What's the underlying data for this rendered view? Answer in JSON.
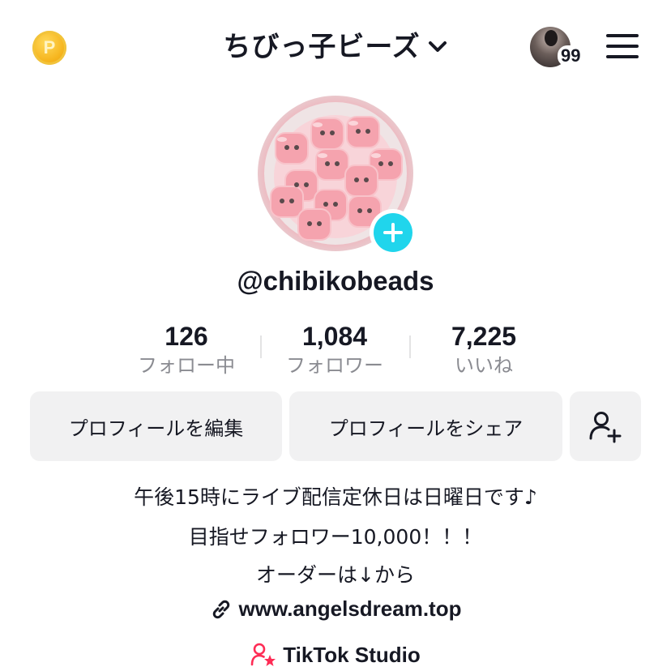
{
  "header": {
    "coin_symbol": "P",
    "title": "ちびっ子ビーズ",
    "notification_count": "99"
  },
  "profile": {
    "username": "@chibikobeads"
  },
  "stats": [
    {
      "value": "126",
      "label": "フォロー中"
    },
    {
      "value": "1,084",
      "label": "フォロワー"
    },
    {
      "value": "7,225",
      "label": "いいね"
    }
  ],
  "actions": {
    "edit_profile": "プロフィールを編集",
    "share_profile": "プロフィールをシェア"
  },
  "bio": {
    "line1": "午後15時にライブ配信定休日は日曜日です♪",
    "line2": "目指せフォロワー10,000！！！",
    "line3": "オーダーは↓から"
  },
  "link": {
    "url": "www.angelsdream.top"
  },
  "studio": {
    "label": "TikTok Studio"
  },
  "colors": {
    "accent": "#20d5ec",
    "studio_icon": "#fe2c55",
    "coin": "#f6b51e",
    "button_bg": "#f1f1f2",
    "muted_text": "#8a8b91"
  },
  "icons": {
    "coin": "coin-icon",
    "dropdown": "chevron-down-icon",
    "menu": "hamburger-menu-icon",
    "add_avatar": "plus-icon",
    "add_friend": "add-user-icon",
    "link": "link-icon",
    "studio": "studio-person-star-icon"
  }
}
